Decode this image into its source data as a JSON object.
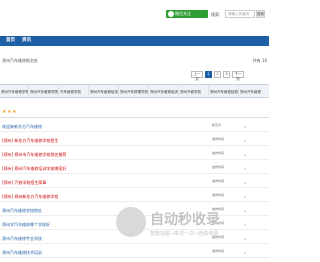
{
  "header": {
    "wechat_label": "微信关注",
    "search_label": "搜索:",
    "search_placeholder": "请输入关键词",
    "search_button": "搜索"
  },
  "nav": [
    {
      "label": "首页"
    },
    {
      "label": "资讯"
    }
  ],
  "breadcrumb": "郑州汽车维修报名处",
  "breadcrumb_right": "共有 10",
  "pager": [
    "上一页",
    "1",
    "2",
    "3",
    "下一页"
  ],
  "table_headers": [
    "郑州汽车维修学校",
    "郑州汽车维修学院",
    "汽车维修学校",
    "郑州汽车维修培训",
    "郑州汽车修理学校",
    "郑州汽车维修培训学校",
    "郑州汽修学校",
    "郑州汽车维修技校",
    "郑州汽车维修"
  ],
  "rows": [
    {
      "title": "欢迎来新东方汽车维修",
      "stars": "★★★",
      "meta": "新东方",
      "stamp": "3"
    },
    {
      "title": "[郑州] 新东方汽车维修学校招生",
      "meta": "发布时间",
      "stamp": "1"
    },
    {
      "title": "[郑州] 郑州市汽车维修学校排名推荐",
      "meta": "发布时间",
      "stamp": "1"
    },
    {
      "title": "[郑州] 郑州汽车维修培训学校哪家好",
      "meta": "发布时间",
      "stamp": "1"
    },
    {
      "title": "[郑州] 汽修学校招生简章",
      "meta": "发布时间",
      "stamp": "1"
    },
    {
      "title": "[郑州] 郑州新东方汽车维修学校",
      "meta": "发布时间",
      "stamp": "1"
    },
    {
      "title": "郑州汽车维修学校地址",
      "meta": "发布时间",
      "stamp": "1"
    },
    {
      "title": "郑州学汽车维修哪个学校好",
      "meta": "发布时间",
      "stamp": "1"
    },
    {
      "title": "郑州汽车维修专业学校",
      "meta": "发布时间",
      "stamp": "1"
    },
    {
      "title": "郑州汽车维修技术培训",
      "meta": "发布时间",
      "stamp": "1"
    }
  ],
  "watermark": {
    "title": "自动秒收录",
    "subtitle": "智能挖掘→来访一次→自动收录"
  }
}
